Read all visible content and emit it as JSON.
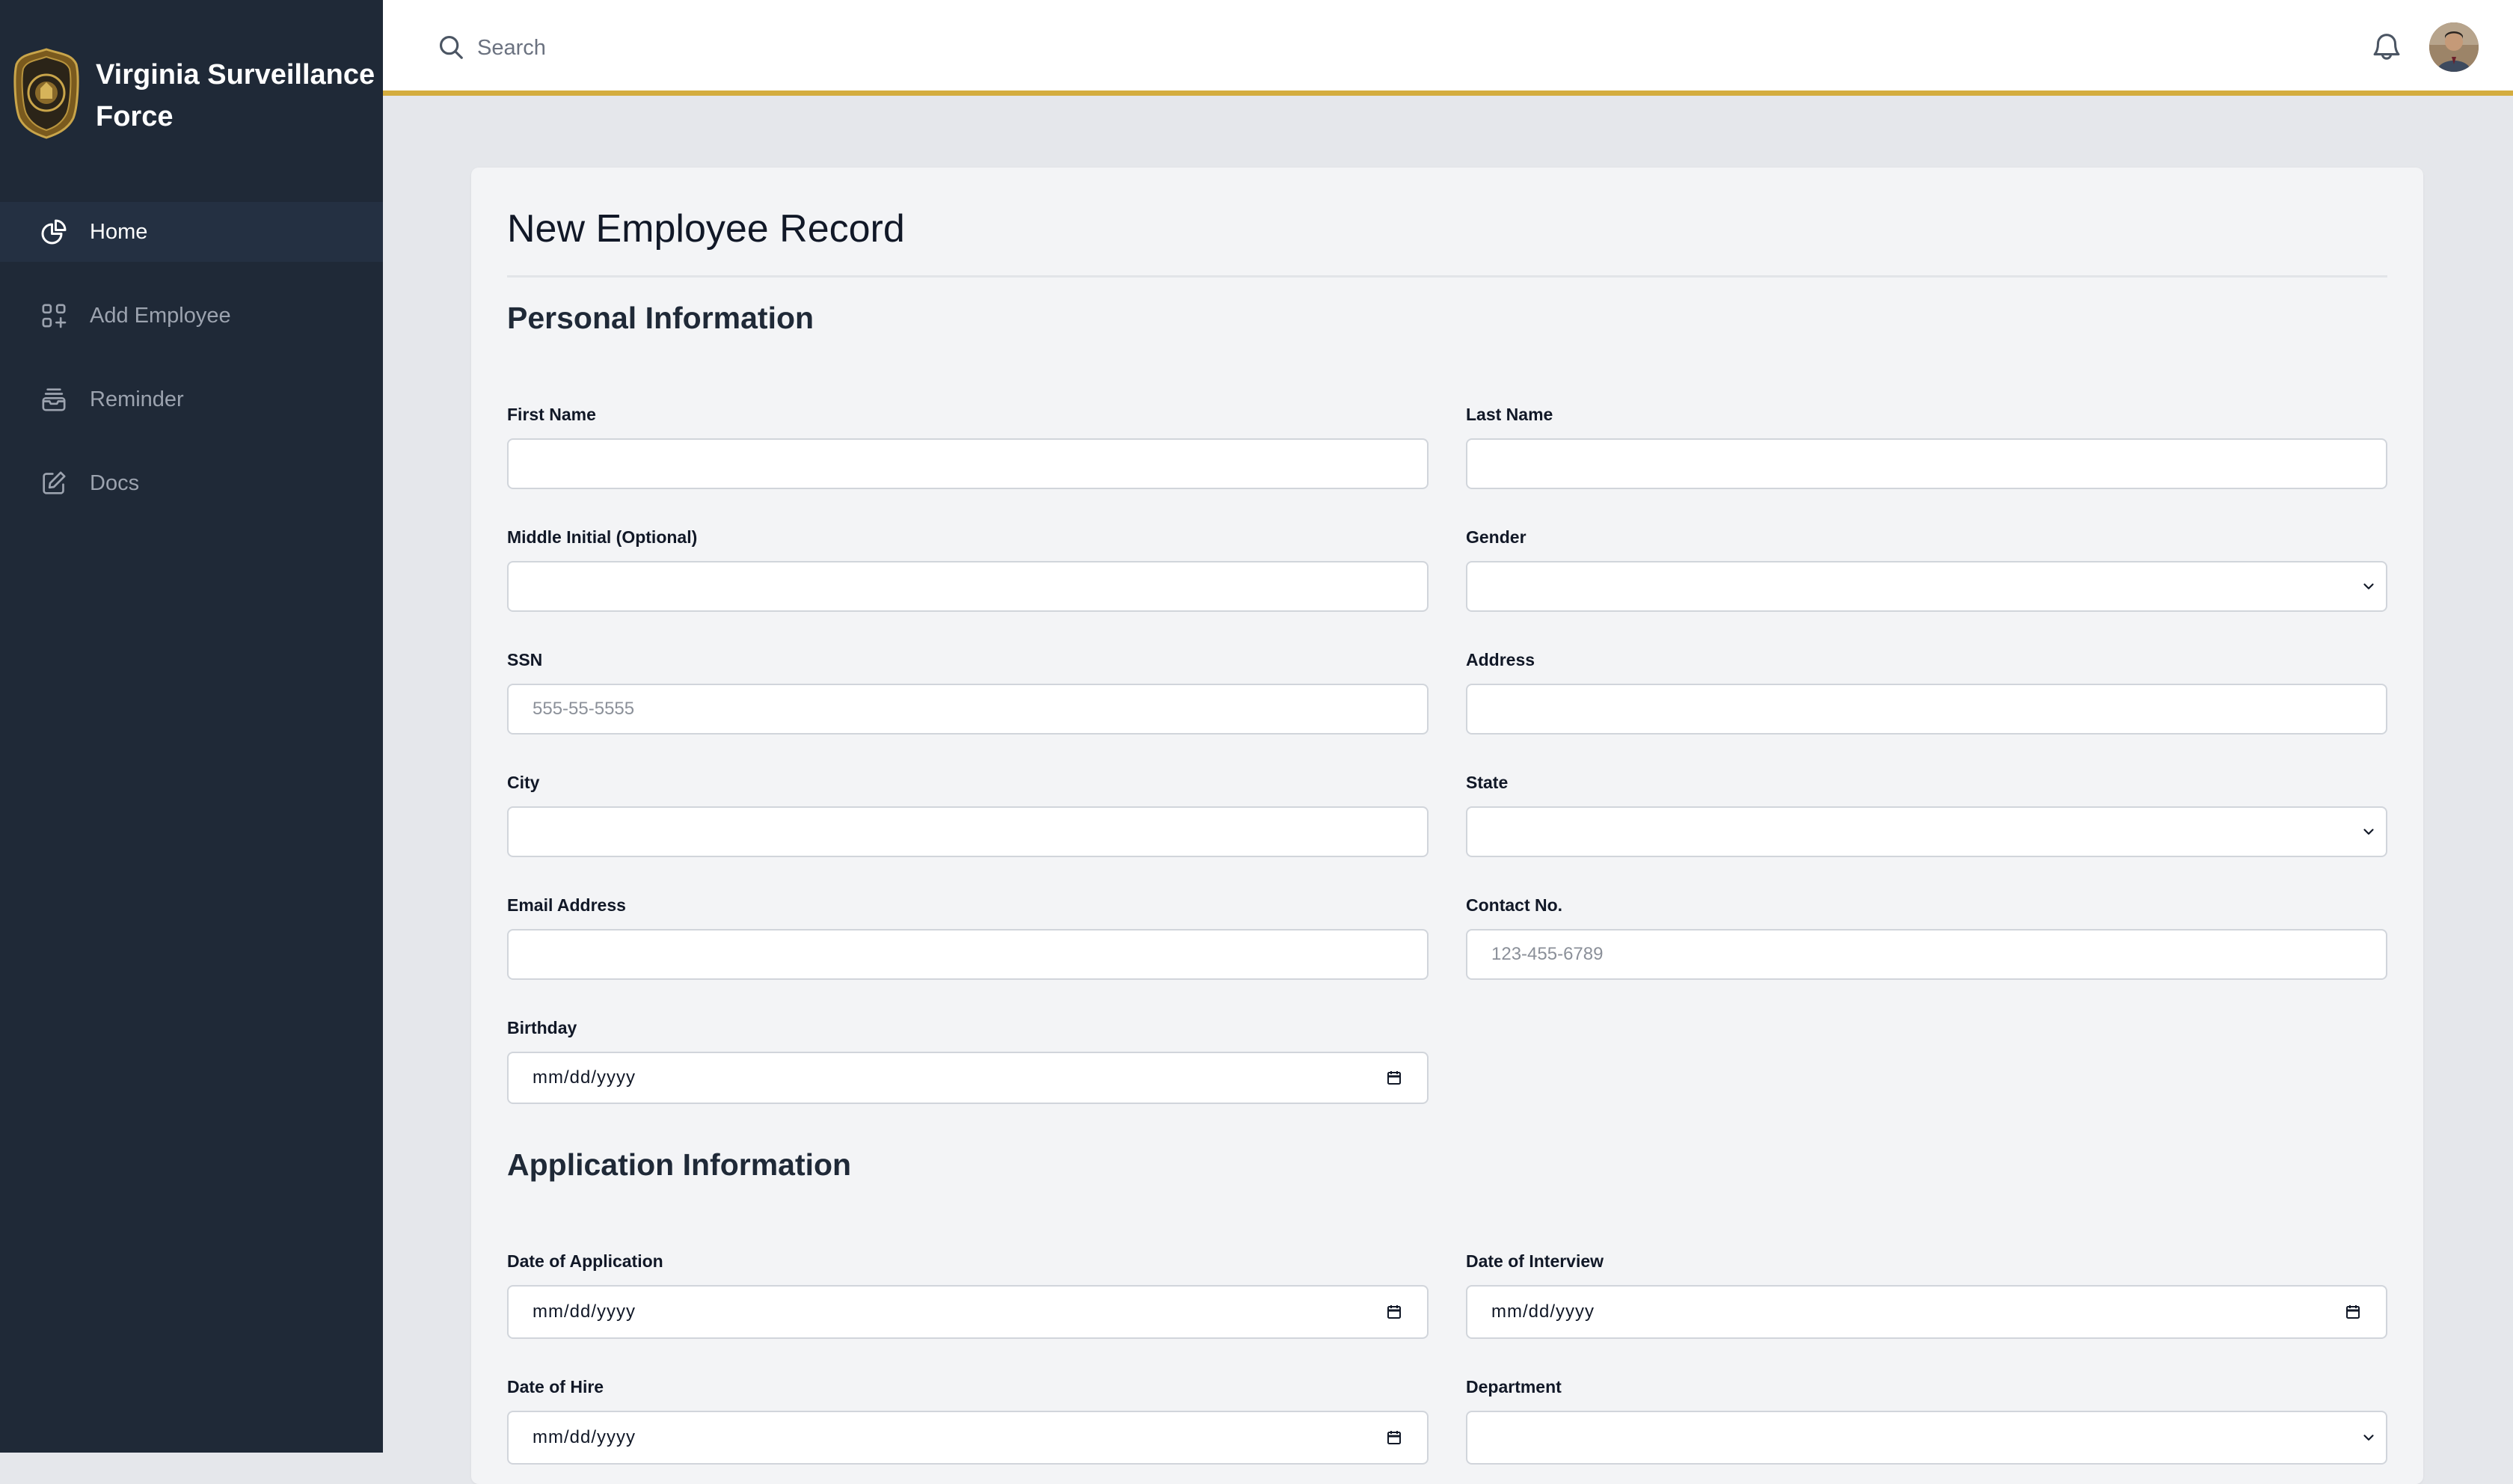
{
  "brand": {
    "name": "Virginia Surveillance Force"
  },
  "nav": [
    {
      "label": "Home",
      "icon": "chart-pie-icon",
      "active": true
    },
    {
      "label": "Add Employee",
      "icon": "grid-plus-icon",
      "active": false
    },
    {
      "label": "Reminder",
      "icon": "inbox-stack-icon",
      "active": false
    },
    {
      "label": "Docs",
      "icon": "pencil-square-icon",
      "active": false
    }
  ],
  "topbar": {
    "search_placeholder": "Search",
    "accent_color": "#d4ad3f"
  },
  "form": {
    "title": "New Employee Record",
    "personal": {
      "title": "Personal Information",
      "first_name": {
        "label": "First Name",
        "value": ""
      },
      "last_name": {
        "label": "Last Name",
        "value": ""
      },
      "middle_initial": {
        "label": "Middle Initial (Optional)",
        "value": ""
      },
      "gender": {
        "label": "Gender",
        "value": ""
      },
      "ssn": {
        "label": "SSN",
        "placeholder": "555-55-5555",
        "value": ""
      },
      "address": {
        "label": "Address",
        "value": ""
      },
      "city": {
        "label": "City",
        "value": ""
      },
      "state": {
        "label": "State",
        "value": ""
      },
      "email": {
        "label": "Email Address",
        "value": ""
      },
      "contact": {
        "label": "Contact No.",
        "placeholder": "123-455-6789",
        "value": ""
      },
      "birthday": {
        "label": "Birthday",
        "placeholder": "mm/dd/yyyy"
      }
    },
    "application": {
      "title": "Application Information",
      "date_of_application": {
        "label": "Date of Application",
        "placeholder": "mm/dd/yyyy"
      },
      "date_of_interview": {
        "label": "Date of Interview",
        "placeholder": "mm/dd/yyyy"
      },
      "date_of_hire": {
        "label": "Date of Hire",
        "placeholder": "mm/dd/yyyy"
      },
      "department": {
        "label": "Department",
        "value": ""
      }
    }
  }
}
